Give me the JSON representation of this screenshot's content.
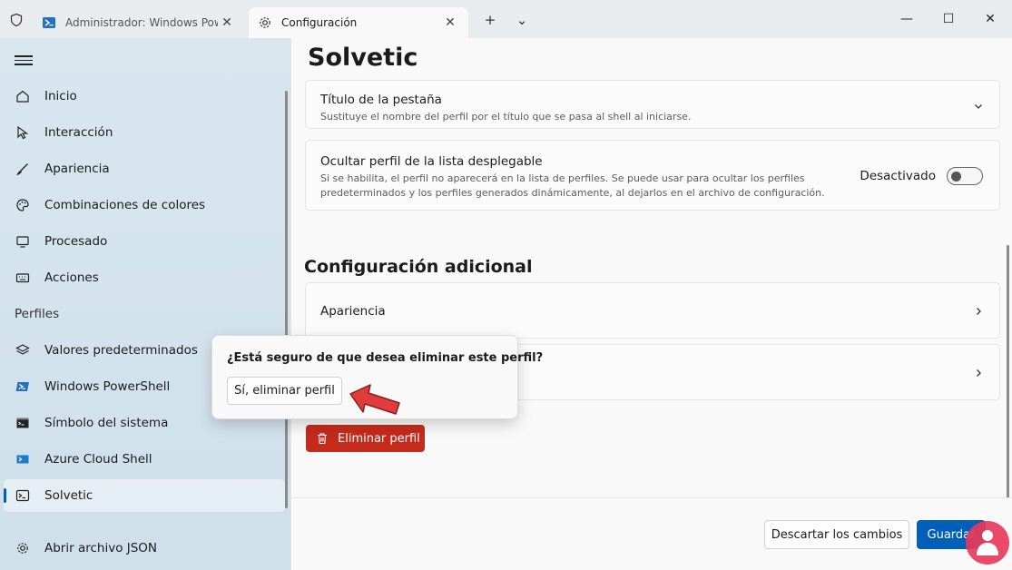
{
  "titlebar": {
    "tabs": [
      {
        "label": "Administrador: Windows Powe",
        "icon": "powershell-icon",
        "active": false
      },
      {
        "label": "Configuración",
        "icon": "gear-icon",
        "active": true
      }
    ],
    "new_tab": "+",
    "dropdown": "⌄",
    "minimize": "—",
    "maximize": "☐",
    "close": "✕"
  },
  "sidebar": {
    "items": [
      {
        "label": "Inicio",
        "icon": "home-icon"
      },
      {
        "label": "Interacción",
        "icon": "pointer-icon"
      },
      {
        "label": "Apariencia",
        "icon": "brush-icon"
      },
      {
        "label": "Combinaciones de colores",
        "icon": "palette-icon"
      },
      {
        "label": "Procesado",
        "icon": "monitor-icon"
      },
      {
        "label": "Acciones",
        "icon": "keyboard-icon"
      }
    ],
    "profiles_header": "Perfiles",
    "profiles": [
      {
        "label": "Valores predeterminados",
        "icon": "layers-icon"
      },
      {
        "label": "Windows PowerShell",
        "icon": "powershell-icon"
      },
      {
        "label": "Símbolo del sistema",
        "icon": "cmd-icon"
      },
      {
        "label": "Azure Cloud Shell",
        "icon": "azure-icon"
      },
      {
        "label": "Solvetic",
        "icon": "terminal-icon",
        "selected": true
      }
    ],
    "open_json": {
      "label": "Abrir archivo JSON",
      "icon": "gear-icon"
    }
  },
  "main": {
    "title": "Solvetic",
    "tab_title_card": {
      "title": "Título de la pestaña",
      "description": "Sustituye el nombre del perfil por el título que se pasa al shell al iniciarse."
    },
    "hide_profile_card": {
      "title": "Ocultar perfil de la lista desplegable",
      "description_line1": "Si se habilita, el perfil no aparecerá en la lista de perfiles. Se puede usar para ocultar los perfiles",
      "description_line2": "predeterminados y los perfiles generados dinámicamente, al dejarlos en el archivo de configuración.",
      "toggle_label": "Desactivado"
    },
    "additional_title": "Configuración adicional",
    "appearance_card": {
      "title": "Apariencia"
    },
    "delete_button": "Eliminar perfil",
    "footer": {
      "discard": "Descartar los cambios",
      "save": "Guardar"
    }
  },
  "flyout": {
    "question": "¿Está seguro de que desea eliminar este perfil?",
    "confirm": "Sí, eliminar perfil"
  },
  "colors": {
    "accent": "#005fb8",
    "danger": "#c42b1c",
    "arrow": "#e03c3c"
  }
}
